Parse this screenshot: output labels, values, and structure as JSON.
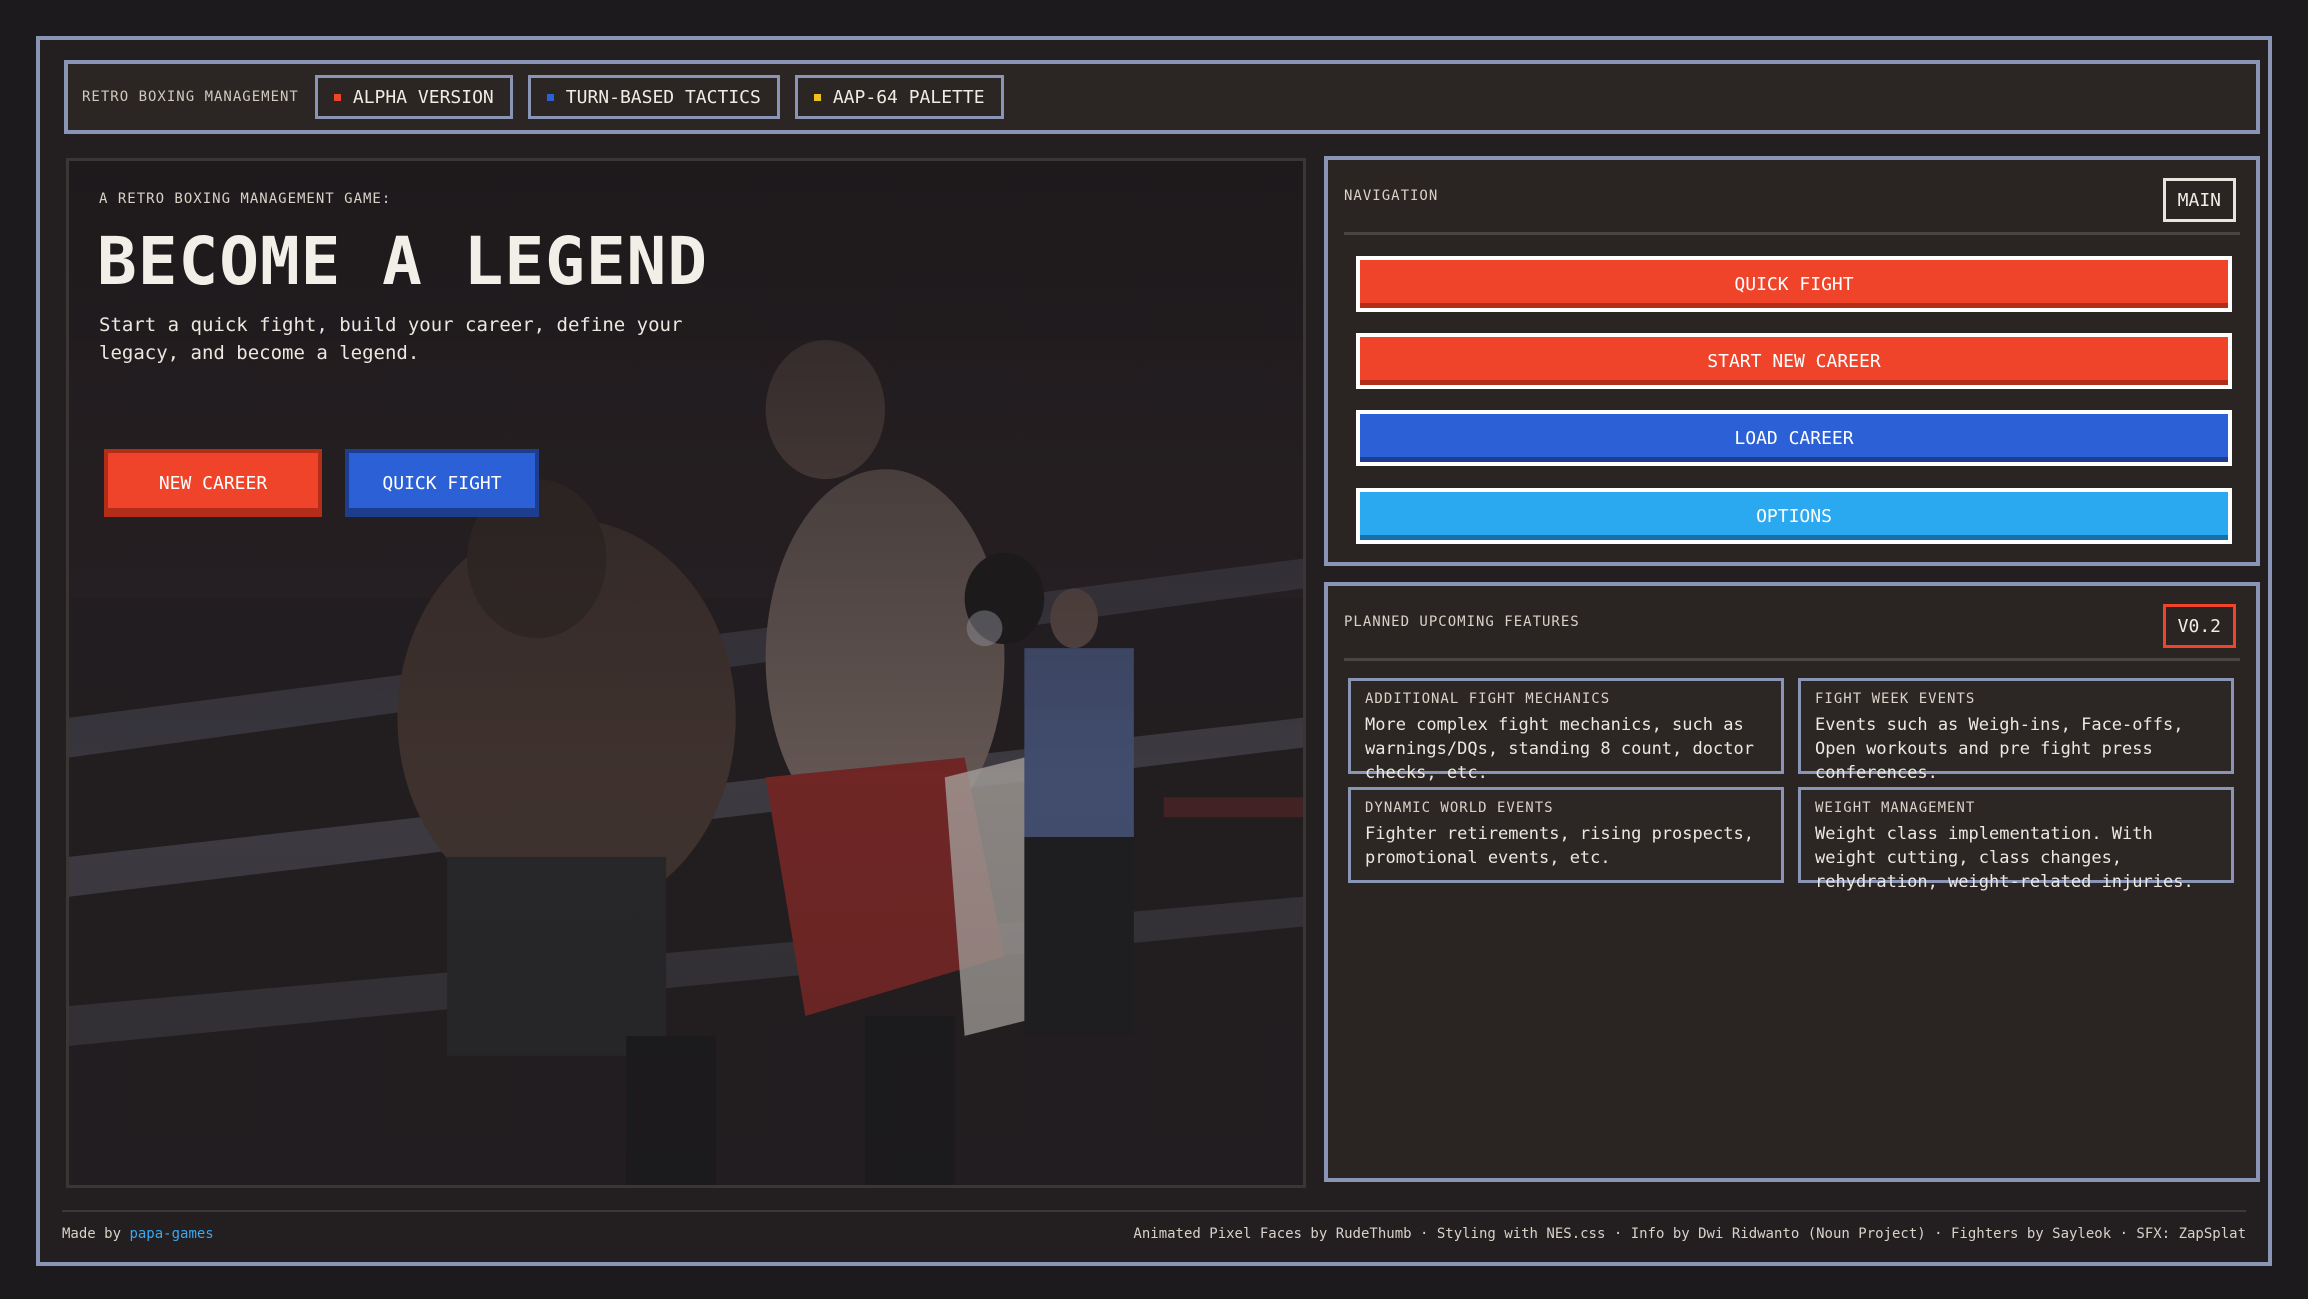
{
  "header": {
    "brand": "RETRO BOXING MANAGEMENT",
    "tags": [
      {
        "label": "ALPHA VERSION",
        "color": "#f0442a"
      },
      {
        "label": "TURN-BASED TACTICS",
        "color": "#2c60d6"
      },
      {
        "label": "AAP-64 PALETTE",
        "color": "#f0c020"
      }
    ]
  },
  "hero": {
    "eyebrow": "A RETRO BOXING MANAGEMENT GAME:",
    "headline": "BECOME A LEGEND",
    "description": "Start a quick fight, build your career, define your legacy, and become a legend.",
    "primary_button": "NEW CAREER",
    "secondary_button": "QUICK FIGHT",
    "image": "boxing-ring-fight-scene"
  },
  "navigation": {
    "title": "NAVIGATION",
    "badge": "MAIN",
    "buttons": [
      {
        "label": "QUICK FIGHT",
        "style": "red"
      },
      {
        "label": "START NEW CAREER",
        "style": "red"
      },
      {
        "label": "LOAD CAREER",
        "style": "blue"
      },
      {
        "label": "OPTIONS",
        "style": "cyan"
      }
    ]
  },
  "features": {
    "title": "PLANNED UPCOMING FEATURES",
    "badge": "V0.2",
    "items": [
      {
        "title": "ADDITIONAL FIGHT MECHANICS",
        "body": "More complex fight mechanics, such as warnings/DQs, standing 8 count, doctor checks, etc."
      },
      {
        "title": "FIGHT WEEK EVENTS",
        "body": "Events such as Weigh-ins, Face-offs, Open workouts and pre fight press conferences."
      },
      {
        "title": "DYNAMIC WORLD EVENTS",
        "body": "Fighter retirements, rising prospects, promotional events, etc."
      },
      {
        "title": "WEIGHT MANAGEMENT",
        "body": "Weight class implementation. With weight cutting, class changes, rehydration, weight-related injuries."
      }
    ]
  },
  "footer": {
    "made_by_prefix": "Made by",
    "made_by_link": "papa-games",
    "credits": "Animated Pixel Faces by RudeThumb · Styling with NES.css · Info by Dwi Ridwanto (Noun Project) · Fighters by Sayleok · SFX: ZapSplat"
  },
  "colors": {
    "accent_red": "#f0442a",
    "accent_blue": "#2c60d6",
    "accent_cyan": "#2aa8f0",
    "border": "#8a94b4",
    "background": "#231f21"
  }
}
